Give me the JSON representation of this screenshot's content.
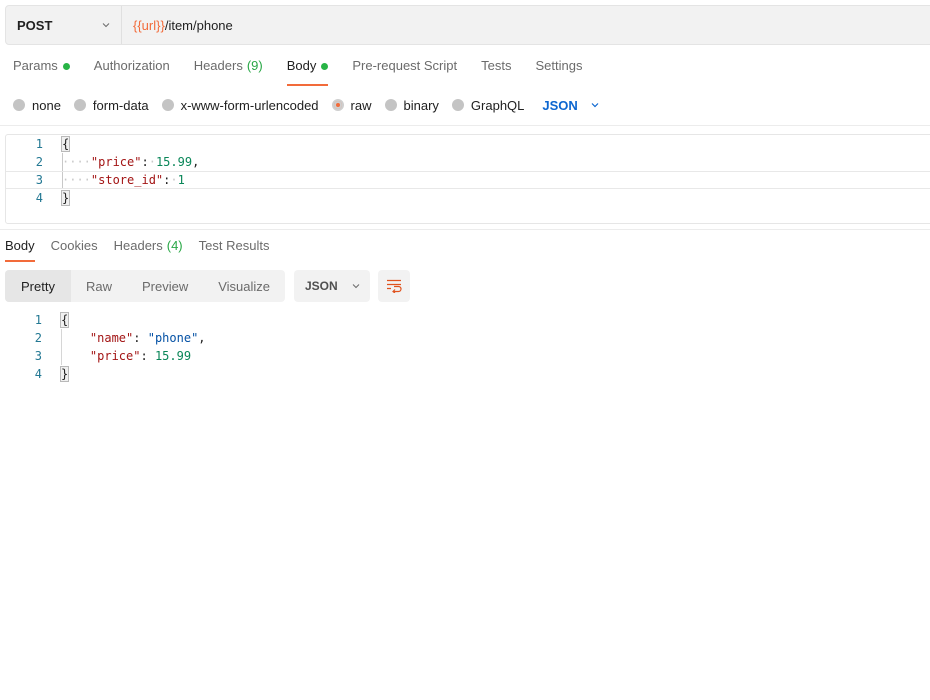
{
  "request": {
    "method": "POST",
    "url_variable": "{{url}}",
    "url_path": "/item/phone"
  },
  "request_tabs": [
    {
      "label": "Params",
      "dot": true
    },
    {
      "label": "Authorization"
    },
    {
      "label": "Headers",
      "count": "(9)"
    },
    {
      "label": "Body",
      "dot": true,
      "active": true
    },
    {
      "label": "Pre-request Script"
    },
    {
      "label": "Tests"
    },
    {
      "label": "Settings"
    }
  ],
  "body_types": {
    "options": [
      "none",
      "form-data",
      "x-www-form-urlencoded",
      "raw",
      "binary",
      "GraphQL"
    ],
    "selected": "raw",
    "language": "JSON"
  },
  "request_body": {
    "line_numbers": [
      "1",
      "2",
      "3",
      "4"
    ],
    "open_brace": "{",
    "close_brace": "}",
    "fields": [
      {
        "key": "\"price\"",
        "value": "15.99",
        "trailing": ","
      },
      {
        "key": "\"store_id\"",
        "value": "1",
        "trailing": ""
      }
    ]
  },
  "response_tabs": [
    {
      "label": "Body",
      "active": true
    },
    {
      "label": "Cookies"
    },
    {
      "label": "Headers",
      "count": "(4)"
    },
    {
      "label": "Test Results"
    }
  ],
  "response_toolbar": {
    "views": [
      "Pretty",
      "Raw",
      "Preview",
      "Visualize"
    ],
    "active_view": "Pretty",
    "format": "JSON",
    "wrap_icon": "wrap-lines-icon"
  },
  "response_body": {
    "line_numbers": [
      "1",
      "2",
      "3",
      "4"
    ],
    "open_brace": "{",
    "close_brace": "}",
    "fields": [
      {
        "key": "\"name\"",
        "value": "\"phone\"",
        "trailing": ","
      },
      {
        "key": "\"price\"",
        "value": "15.99",
        "trailing": ""
      }
    ]
  },
  "colors": {
    "accent": "#f26b3a",
    "success": "#28b446",
    "link": "#0c66d0"
  }
}
